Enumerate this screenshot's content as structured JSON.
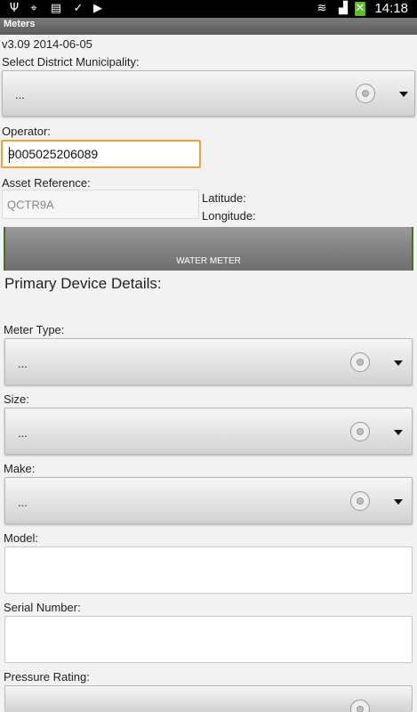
{
  "status_bar": {
    "time": "14:18",
    "icons": [
      "usb-icon",
      "gps-icon",
      "no-sim-icon",
      "shopping-bag-icon",
      "play-store-icon",
      "wifi-icon",
      "signal-icon",
      "battery-charging-icon"
    ]
  },
  "app": {
    "title": "Meters"
  },
  "version": "v3.09 2014-06-05",
  "district": {
    "label": "Select District Municipality:",
    "value": "..."
  },
  "operator": {
    "label": "Operator:",
    "value": "9005025206089"
  },
  "asset": {
    "label": "Asset Reference:",
    "value": "QCTR9A"
  },
  "location": {
    "latitude_label": "Latitude:",
    "longitude_label": "Longitude:"
  },
  "water_meter_button": "WATER METER",
  "primary": {
    "title": "Primary Device Details:",
    "meter_type": {
      "label": "Meter Type:",
      "value": "..."
    },
    "size": {
      "label": "Size:",
      "value": "..."
    },
    "make": {
      "label": "Make:",
      "value": "..."
    },
    "model": {
      "label": "Model:",
      "value": ""
    },
    "serial": {
      "label": "Serial Number:",
      "value": ""
    },
    "pressure": {
      "label": "Pressure Rating:",
      "value": ""
    }
  },
  "colors": {
    "focus_border": "#f0a23a",
    "title_bar": "#6a6a6a",
    "status_bar": "#000000",
    "button_edge": "#4a6e2e"
  }
}
